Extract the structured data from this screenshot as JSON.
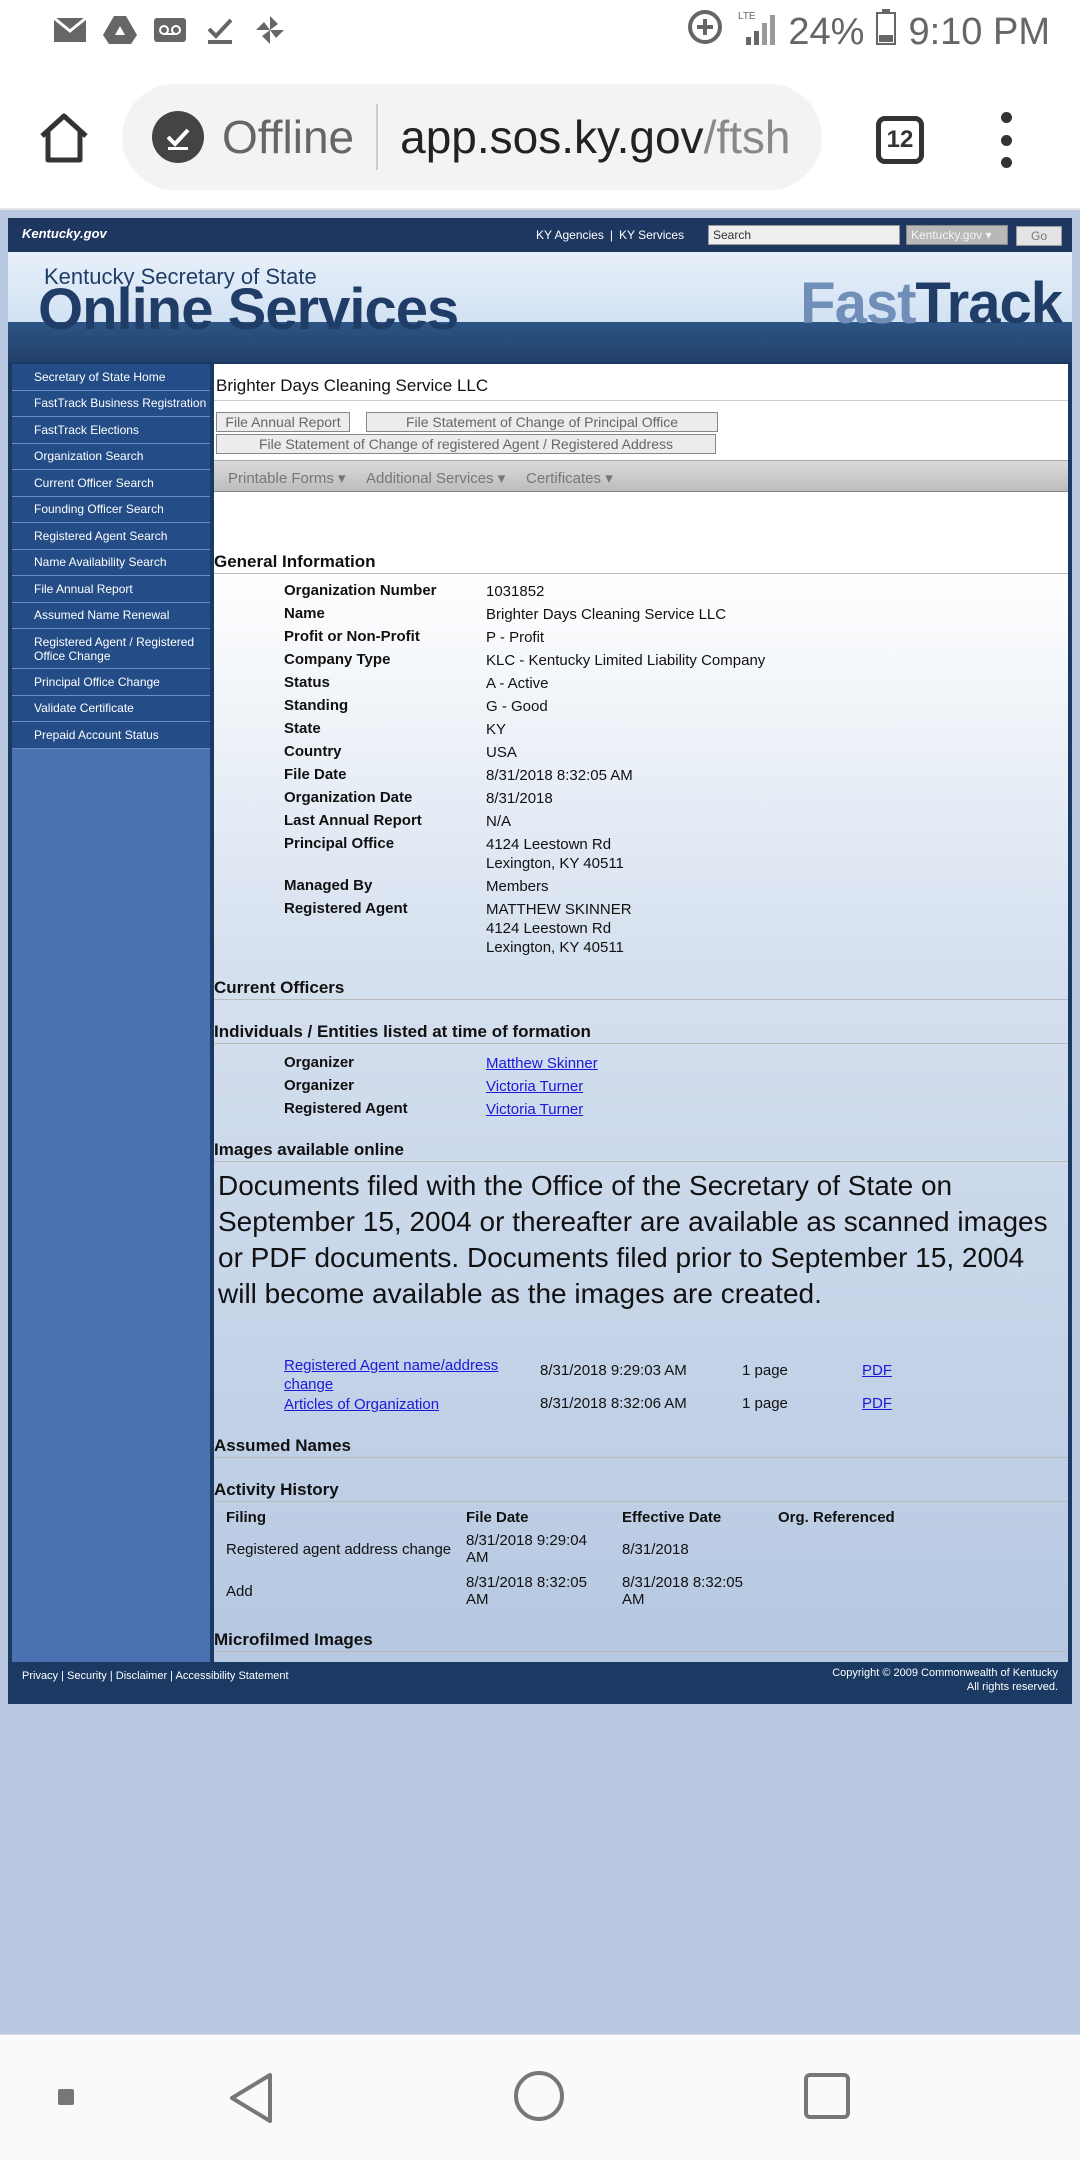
{
  "status_bar": {
    "battery": "24%",
    "time": "9:10 PM",
    "network": "LTE",
    "icons": [
      "gmail-icon",
      "drive-icon",
      "voicemail-icon",
      "download-done-icon",
      "pinwheel-icon",
      "data-saver-icon",
      "signal-icon",
      "battery-icon"
    ]
  },
  "browser": {
    "offline_label": "Offline",
    "url_host": "app.sos.ky.gov",
    "url_path": "/ftsh",
    "tab_count": "12"
  },
  "topnav": {
    "logo": "Kentucky.gov",
    "agencies": "KY Agencies",
    "separator": "|",
    "services": "KY Services",
    "search_placeholder": "Search",
    "select_value": "Kentucky.gov ▾",
    "go": "Go"
  },
  "banner": {
    "subtitle": "Kentucky Secretary of State",
    "title": "Online Services",
    "fast": "Fast",
    "track": "Track"
  },
  "sidebar": {
    "items": [
      "Secretary of State Home",
      "FastTrack Business Registration",
      "FastTrack Elections",
      "Organization Search",
      "Current Officer Search",
      "Founding Officer Search",
      "Registered Agent Search",
      "Name Availability Search",
      "File Annual Report",
      "Assumed Name Renewal",
      "Registered Agent / Registered Office Change",
      "Principal Office Change",
      "Validate Certificate",
      "Prepaid Account Status"
    ]
  },
  "main": {
    "org_title": "Brighter Days Cleaning Service LLC",
    "btn_annual": "File Annual Report",
    "btn_principal": "File Statement of Change of Principal Office",
    "btn_agent": "File Statement of Change of registered Agent / Registered Address",
    "menu": [
      "Printable Forms ▾",
      "Additional Services ▾",
      "Certificates ▾"
    ],
    "general_heading": "General Information",
    "general": [
      {
        "label": "Organization Number",
        "value": "1031852"
      },
      {
        "label": "Name",
        "value": "Brighter Days Cleaning Service LLC"
      },
      {
        "label": "Profit or Non-Profit",
        "value": "P - Profit"
      },
      {
        "label": "Company Type",
        "value": "KLC - Kentucky Limited Liability Company"
      },
      {
        "label": "Status",
        "value": "A - Active"
      },
      {
        "label": "Standing",
        "value": "G - Good"
      },
      {
        "label": "State",
        "value": "KY"
      },
      {
        "label": "Country",
        "value": "USA"
      },
      {
        "label": "File Date",
        "value": "8/31/2018 8:32:05 AM"
      },
      {
        "label": "Organization Date",
        "value": "8/31/2018"
      },
      {
        "label": "Last Annual Report",
        "value": "N/A"
      },
      {
        "label": "Principal Office",
        "value": "4124 Leestown Rd\nLexington, KY 40511"
      },
      {
        "label": "Managed By",
        "value": "Members"
      },
      {
        "label": "Registered Agent",
        "value": "MATTHEW SKINNER\n4124 Leestown Rd\nLexington, KY 40511"
      }
    ],
    "current_officers_heading": "Current Officers",
    "formation_heading": "Individuals / Entities listed at time of formation",
    "formation": [
      {
        "label": "Organizer",
        "value": "Matthew Skinner"
      },
      {
        "label": "Organizer",
        "value": "Victoria Turner"
      },
      {
        "label": "Registered Agent",
        "value": "Victoria Turner"
      }
    ],
    "images_heading": "Images available online",
    "images_note": "Documents filed with the Office of the Secretary of State on September 15, 2004 or thereafter are available as scanned images or PDF documents. Documents filed prior to September 15, 2004 will become available as the images are created.",
    "documents": [
      {
        "name": "Registered Agent name/address change",
        "date": "8/31/2018 9:29:03 AM",
        "pages": "1 page",
        "link": "PDF"
      },
      {
        "name": "Articles of Organization",
        "date": "8/31/2018 8:32:06 AM",
        "pages": "1 page",
        "link": "PDF"
      }
    ],
    "assumed_heading": "Assumed Names",
    "activity_heading": "Activity History",
    "activity_columns": [
      "Filing",
      "File Date",
      "Effective Date",
      "Org. Referenced"
    ],
    "activity_rows": [
      {
        "filing": "Registered agent address change",
        "file_date": "8/31/2018 9:29:04 AM",
        "effective": "8/31/2018",
        "org": ""
      },
      {
        "filing": "Add",
        "file_date": "8/31/2018 8:32:05 AM",
        "effective": "8/31/2018 8:32:05 AM",
        "org": ""
      }
    ],
    "microfilmed_heading": "Microfilmed Images"
  },
  "footer": {
    "links": [
      "Privacy",
      "Security",
      "Disclaimer",
      "Accessibility Statement"
    ],
    "copyright": "Copyright © 2009 Commonwealth of Kentucky",
    "rights": "All rights reserved."
  }
}
